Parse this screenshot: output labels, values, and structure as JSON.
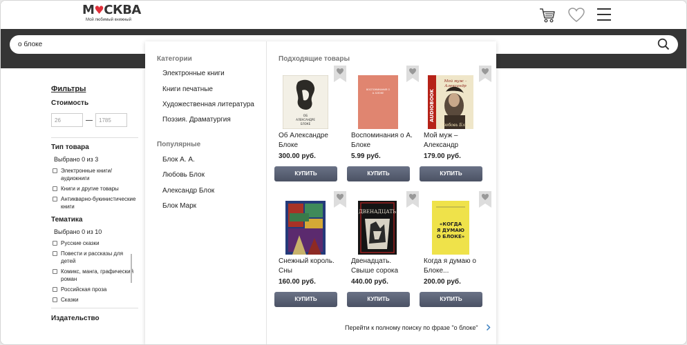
{
  "header": {
    "logo_text": "МОСКВА",
    "logo_tagline": "Мой любимый книжный",
    "cart_icon": "cart-icon",
    "favorites_icon": "heart-icon",
    "menu_icon": "menu-icon"
  },
  "search": {
    "value": "о блоке",
    "icon": "search-icon"
  },
  "filters": {
    "title": "Фильтры",
    "price": {
      "heading": "Стоимость",
      "min": "26",
      "max": "1785"
    },
    "type": {
      "heading": "Тип товара",
      "selected": "Выбрано 0 из 3",
      "options": [
        "Электронные книги/ аудиокниги",
        "Книги и другие товары",
        "Антикварно-букинистические книги"
      ]
    },
    "theme": {
      "heading": "Тематика",
      "selected": "Выбрано 0 из 10",
      "options": [
        "Русские сказки",
        "Повести и рассказы для детей",
        "Комикс, манга, графический роман",
        "Российская проза",
        "Сказки"
      ]
    },
    "publisher": {
      "heading": "Издательство"
    }
  },
  "dropdown": {
    "categories_title": "Категории",
    "categories": [
      "Электронные книги",
      "Книги печатные",
      "Художественная литература",
      "Поэзия. Драматургия"
    ],
    "popular_title": "Популярные",
    "popular": [
      "Блок А. А.",
      "Любовь Блок",
      "Александр Блок",
      "Блок Марк"
    ],
    "products_title": "Подходящие товары",
    "products": [
      {
        "title": "Об Александре Блоке",
        "price": "300.00 руб.",
        "buy": "КУПИТЬ",
        "cover_text": "ОБ АЛЕКСАНДРЕ БЛОКЕ"
      },
      {
        "title": "Воспоминания о А. Блоке",
        "price": "5.99 руб.",
        "buy": "КУПИТЬ",
        "cover_text": "ВОСПОМИНАНИЯ О А. БЛОКЕ"
      },
      {
        "title": "Мой муж – Александр",
        "price": "179.00 руб.",
        "buy": "КУПИТЬ",
        "cover_text": "AUDIOBOOK"
      },
      {
        "title": "Снежный король. Сны",
        "price": "160.00 руб.",
        "buy": "КУПИТЬ",
        "cover_text": ""
      },
      {
        "title": "Двенадцать. Свыше сорока",
        "price": "440.00 руб.",
        "buy": "КУПИТЬ",
        "cover_text": "ДВЕНАДЦАТЬ"
      },
      {
        "title": "Когда я думаю о Блоке...",
        "price": "200.00 руб.",
        "buy": "КУПИТЬ",
        "cover_text": "«КОГДА Я ДУМАЮ О БЛОКЕ»"
      }
    ],
    "full_search_link": "Перейти к полному поиску по фразе \"о блоке\""
  }
}
